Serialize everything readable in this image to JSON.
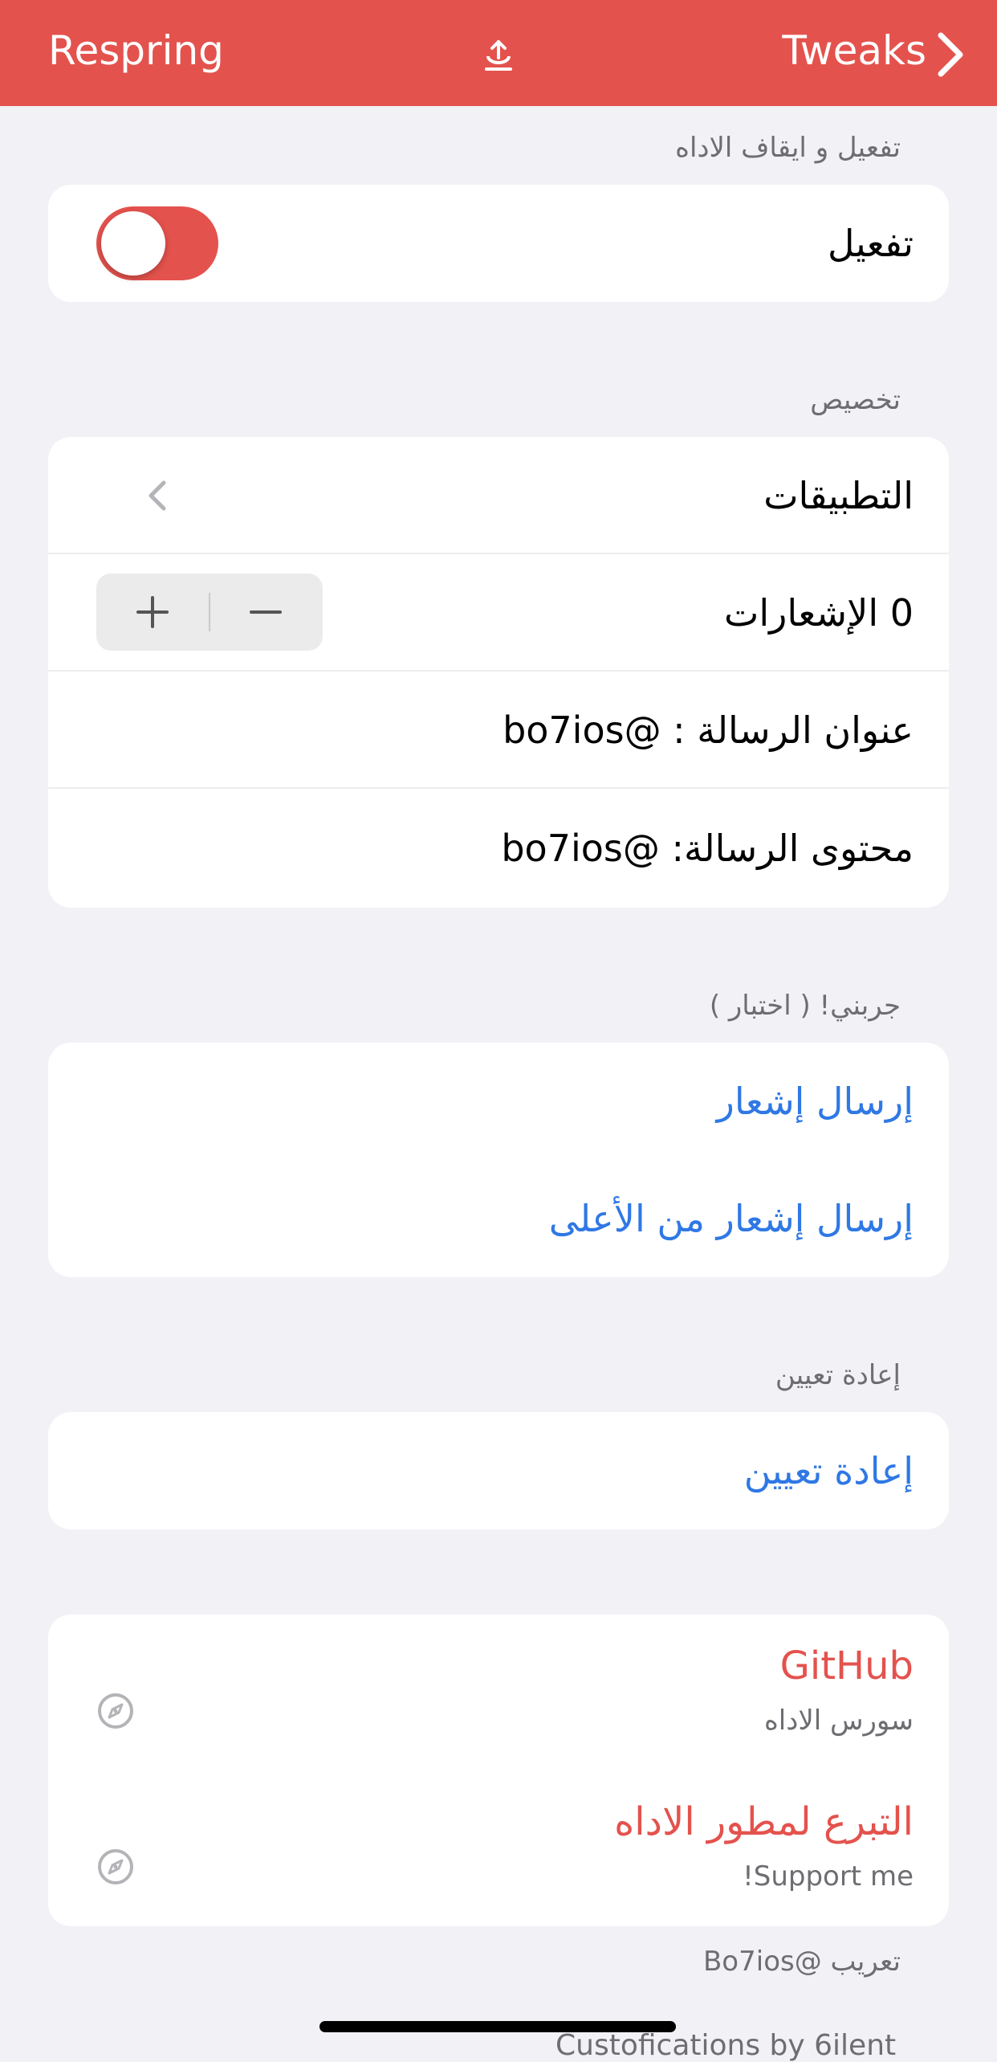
{
  "navbar": {
    "left_button": "Respring",
    "center_icon": "upload-icon",
    "right_button": "Tweaks",
    "right_icon": "chevron-right-icon",
    "color": "#e4524d"
  },
  "sections": {
    "enable": {
      "header": "تفعيل و ايقاف الاداه",
      "row_label": "تفعيل",
      "toggle_on": true
    },
    "customize": {
      "header": "تخصيص",
      "apps_label": "التطبيقات",
      "notifications_label": "0 الإشعارات",
      "notifications_count": 0,
      "stepper_minus": "minus-icon",
      "stepper_plus": "plus-icon",
      "message_title": "عنوان الرسالة : @bo7ios",
      "message_body": "محتوى الرسالة: @bo7ios"
    },
    "test": {
      "header": "جربني! ( اختبار )",
      "send_notification": "إرسال إشعار",
      "send_top_notification": "إرسال إشعار من الأعلى"
    },
    "reset": {
      "header": "إعادة تعيين",
      "reset_label": "إعادة تعيين"
    },
    "links": {
      "items": [
        {
          "title": "GitHub",
          "subtitle": "سورس الاداه",
          "icon": "compass-icon"
        },
        {
          "title": "التبرع لمطور الاداه",
          "subtitle": "Support me!",
          "icon": "compass-icon"
        }
      ]
    }
  },
  "footer": {
    "credit": "تعريب @Bo7ios",
    "partial": "Custofications by 6ilent"
  },
  "colors": {
    "accent_red": "#e4524d",
    "link_blue": "#2f78e5",
    "background": "#f1f1f6"
  }
}
